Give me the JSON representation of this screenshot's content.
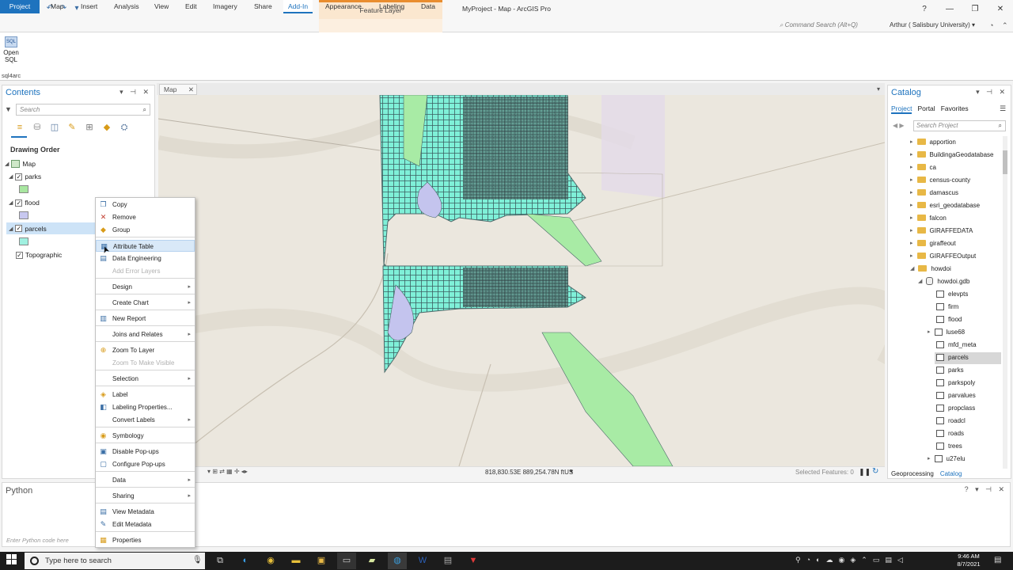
{
  "title_bar": {
    "contextual_tab_group": "Feature Layer",
    "app_title": "MyProject - Map - ArcGIS Pro",
    "window_buttons": [
      "?",
      "—",
      "❐",
      "✕"
    ]
  },
  "ribbon": {
    "tabs": [
      "Project",
      "Map",
      "Insert",
      "Analysis",
      "View",
      "Edit",
      "Imagery",
      "Share",
      "Add-In",
      "Appearance",
      "Labeling",
      "Data"
    ],
    "active_tab": "Add-In",
    "command_search_placeholder": "Command Search (Alt+Q)",
    "user": "Arthur ( Salisbury University) ▾",
    "sql_button": {
      "icon_text": "SQL",
      "label_line1": "Open",
      "label_line2": "SQL"
    },
    "group_label": "sql4arc"
  },
  "contents": {
    "title": "Contents",
    "search_placeholder": "Search",
    "section": "Drawing Order",
    "map": "Map",
    "layers": [
      {
        "name": "parks",
        "checked": true,
        "swatch": "#a8e6a0"
      },
      {
        "name": "flood",
        "checked": true,
        "swatch": "#c8c8f0"
      },
      {
        "name": "parcels",
        "checked": true,
        "swatch": "#a0f0e0"
      },
      {
        "name": "Topographic",
        "checked": true
      }
    ]
  },
  "map_view": {
    "tab": "Map",
    "coordinates": "818,830.53E 889,254.78N ftUS",
    "selected_features": "Selected Features: 0"
  },
  "catalog": {
    "title": "Catalog",
    "tabs": [
      "Project",
      "Portal",
      "Favorites"
    ],
    "search_placeholder": "Search Project",
    "folders": [
      "apportion",
      "BuildingaGeodatabase",
      "ca",
      "census-county",
      "damascus",
      "esri_geodatabase",
      "falcon",
      "GIRAFFEDATA",
      "giraffeout",
      "GIRAFFEOutput",
      "howdoi"
    ],
    "gdb": "howdoi.gdb",
    "gdb_items": [
      "elevpts",
      "firm",
      "flood",
      "luse68",
      "mfd_meta",
      "parcels",
      "parks",
      "parkspoly",
      "parvalues",
      "propclass",
      "roadcl",
      "roads",
      "trees",
      "u27elu"
    ],
    "selected_item": "parcels",
    "bottom_tabs": [
      "Geoprocessing",
      "Catalog"
    ]
  },
  "python": {
    "title": "Python",
    "input_placeholder": "Enter Python code here"
  },
  "context_menu": {
    "items": [
      {
        "label": "Copy",
        "icon": "copy-icon",
        "glyph": "❐"
      },
      {
        "label": "Remove",
        "icon": "remove-icon",
        "glyph": "✕"
      },
      {
        "label": "Group",
        "icon": "group-icon",
        "glyph": "◆"
      },
      {
        "label": "Attribute Table",
        "icon": "table-icon",
        "glyph": "▦",
        "highlighted": true
      },
      {
        "label": "Data Engineering",
        "icon": "data-engineering-icon",
        "glyph": "▤"
      },
      {
        "label": "Add Error Layers",
        "disabled": true
      },
      {
        "label": "Design",
        "submenu": true
      },
      {
        "label": "Create Chart",
        "submenu": true
      },
      {
        "label": "New Report",
        "icon": "report-icon",
        "glyph": "▥"
      },
      {
        "label": "Joins and Relates",
        "submenu": true
      },
      {
        "label": "Zoom To Layer",
        "icon": "zoom-layer-icon",
        "glyph": "⊕"
      },
      {
        "label": "Zoom To Make Visible",
        "disabled": true
      },
      {
        "label": "Selection",
        "submenu": true
      },
      {
        "label": "Label",
        "icon": "label-icon",
        "glyph": "◈"
      },
      {
        "label": "Labeling Properties...",
        "icon": "labeling-properties-icon",
        "glyph": "◧"
      },
      {
        "label": "Convert Labels",
        "submenu": true
      },
      {
        "label": "Symbology",
        "icon": "symbology-icon",
        "glyph": "◉"
      },
      {
        "label": "Disable Pop-ups",
        "icon": "disable-popups-icon",
        "glyph": "▣"
      },
      {
        "label": "Configure Pop-ups",
        "icon": "configure-popups-icon",
        "glyph": "▢"
      },
      {
        "label": "Data",
        "submenu": true
      },
      {
        "label": "Sharing",
        "submenu": true
      },
      {
        "label": "View Metadata",
        "icon": "view-metadata-icon",
        "glyph": "▤"
      },
      {
        "label": "Edit Metadata",
        "icon": "edit-metadata-icon",
        "glyph": "✎"
      },
      {
        "label": "Properties",
        "icon": "properties-icon",
        "glyph": "▦"
      }
    ]
  },
  "taskbar": {
    "search_placeholder": "Type here to search",
    "time": "9:46 AM",
    "date": "8/7/2021"
  },
  "colors": {
    "accent": "#1e73be",
    "contextual": "#e98d2f",
    "parcel_fill": "#7ff0d8",
    "park_fill": "#a8eba5",
    "flood_fill": "#c4c4ee"
  }
}
